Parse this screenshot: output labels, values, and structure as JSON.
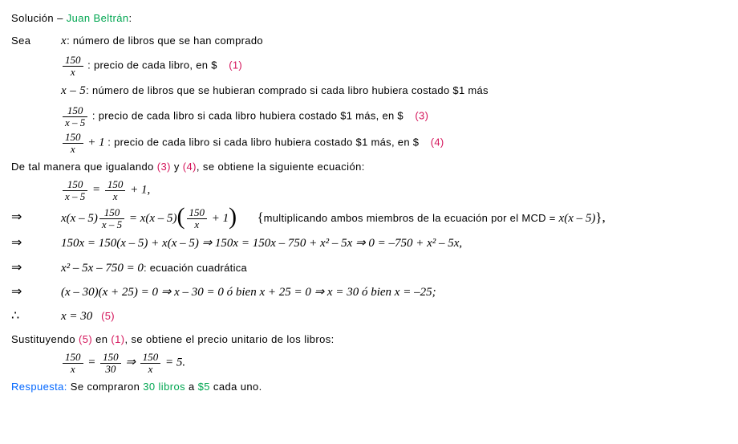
{
  "header": {
    "solucion_label": "Solución – ",
    "author": "Juan Beltrán",
    "colon": ":"
  },
  "defs": {
    "sea": "Sea",
    "x_sym": "x",
    "x_desc": ":  número de libros que se han comprado",
    "f1_num": "150",
    "f1_den": "x",
    "f1_desc": ":  precio de cada libro, en $",
    "ref1": "(1)",
    "l2_expr": "x – 5",
    "l2_desc": ":  número de libros que se hubieran comprado si cada libro hubiera costado $1 más",
    "f3_num": "150",
    "f3_den": "x – 5",
    "f3_desc": ":  precio de cada libro si cada libro hubiera costado $1 más, en $",
    "ref3": "(3)",
    "f4_num": "150",
    "f4_den": "x",
    "f4_tail": " + 1",
    "f4_desc": ":  precio de cada libro si cada libro hubiera costado $1 más, en $",
    "ref4": "(4)"
  },
  "bridge1_a": "De tal manera que igualando ",
  "bridge1_r3": "(3)",
  "bridge1_b": " y ",
  "bridge1_r4": "(4)",
  "bridge1_c": ", se obtiene la siguiente ecuación:",
  "eq1": {
    "lnum": "150",
    "lden": "x – 5",
    "mid": " = ",
    "rnum": "150",
    "rden": "x",
    "tail": " + 1,"
  },
  "imp": "⇒",
  "therefore": "∴",
  "eq2": {
    "a_pre": "x",
    "a_par": "(x – 5)",
    "anum": "150",
    "aden": "x – 5",
    "mid": " = x",
    "b_par": "(x – 5)",
    "bnum": "150",
    "bden": "x",
    "btail": " + 1",
    "note_open": "{",
    "note": "multiplicando ambos miembros de la ecuación por el MCD = ",
    "note_math": "x(x – 5)",
    "note_close": "},"
  },
  "eq3": "150x = 150(x – 5) + x(x – 5)  ⇒  150x = 150x – 750 + x² – 5x  ⇒  0 = –750 + x² – 5x,",
  "eq4_a": "x² – 5x – 750 = 0",
  "eq4_b": ":  ecuación cuadrática",
  "eq5": "(x – 30)(x + 25) = 0  ⇒  x – 30 = 0   ó bien   x + 25 = 0  ⇒  x = 30   ó bien   x = –25;",
  "eq6_a": "x = 30",
  "eq6_ref": "(5)",
  "bridge2_a": "Sustituyendo ",
  "bridge2_r5": "(5)",
  "bridge2_b": " en ",
  "bridge2_r1": "(1)",
  "bridge2_c": ", se obtiene el precio unitario de los libros:",
  "eq7": {
    "a_num": "150",
    "a_den": "x",
    "eq": " = ",
    "b_num": "150",
    "b_den": "30",
    "imp": "  ⇒  ",
    "c_num": "150",
    "c_den": "x",
    "tail": " = 5."
  },
  "answer": {
    "label": "Respuesta:",
    "t1": " Se compraron ",
    "n": "30 libros",
    "t2": " a ",
    "p": "$5",
    "t3": " cada uno."
  }
}
